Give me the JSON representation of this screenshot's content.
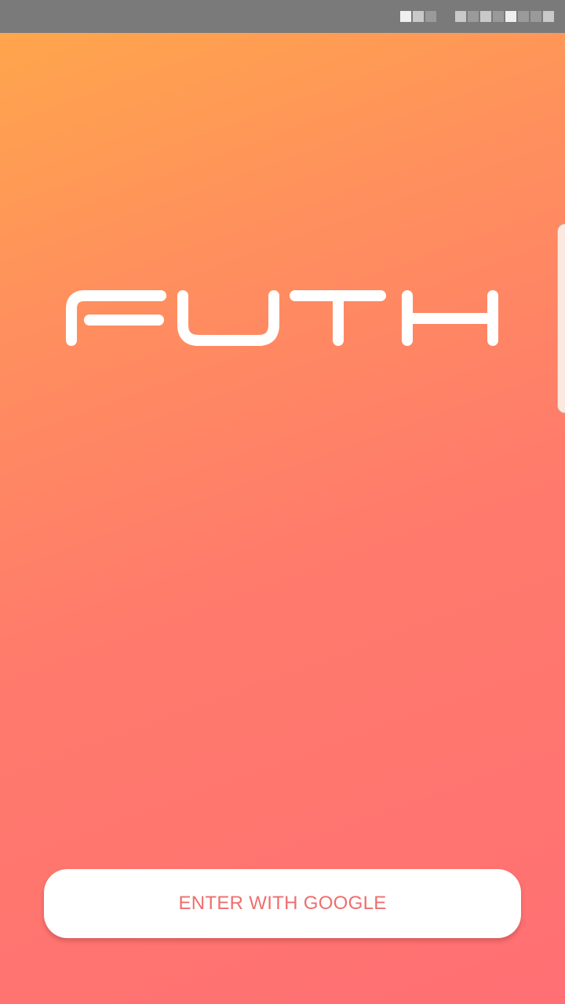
{
  "app": {
    "logo_text": "FUTH"
  },
  "login": {
    "google_button_label": "ENTER WITH GOOGLE"
  },
  "colors": {
    "gradient_top": "#ffa84a",
    "gradient_bottom": "#ff6f74",
    "button_text": "#ee6e6e",
    "status_bar": "#7a7a7a"
  }
}
